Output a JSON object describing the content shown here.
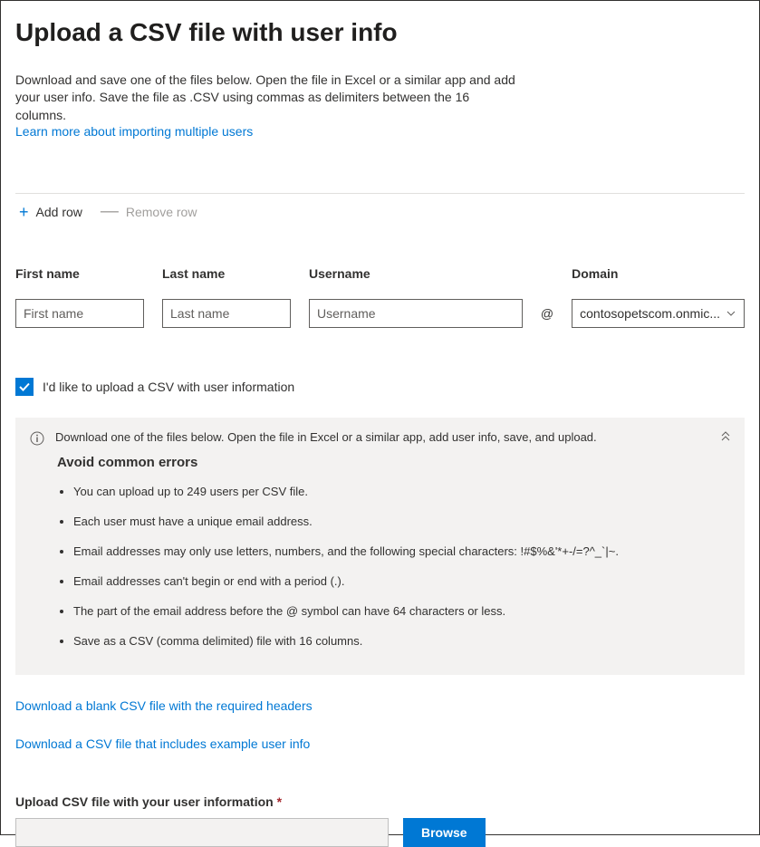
{
  "title": "Upload a CSV file with user info",
  "intro": "Download and save one of the files below. Open the file in Excel or a similar app and add your user info. Save the file as .CSV using commas as delimiters between the 16 columns.",
  "learnMore": "Learn more about importing multiple users",
  "toolbar": {
    "add": "Add row",
    "remove": "Remove row"
  },
  "fields": {
    "first": {
      "label": "First name",
      "placeholder": "First name"
    },
    "last": {
      "label": "Last name",
      "placeholder": "Last name"
    },
    "user": {
      "label": "Username",
      "placeholder": "Username"
    },
    "at": "@",
    "domain": {
      "label": "Domain",
      "value": "contosopetscom.onmic..."
    }
  },
  "checkbox": {
    "label": "I'd like to upload a CSV with user information"
  },
  "info": {
    "header": "Download one of the files below. Open the file in Excel or a similar app, add user info, save, and upload.",
    "subtitle": "Avoid common errors",
    "items": [
      "You can upload up to 249 users per CSV file.",
      "Each user must have a unique email address.",
      "Email addresses may only use letters, numbers, and the following special characters: !#$%&'*+-/=?^_`|~.",
      "Email addresses can't begin or end with a period (.).",
      "The part of the email address before the @ symbol can have 64 characters or less.",
      "Save as a CSV (comma delimited) file with 16 columns."
    ]
  },
  "downloads": {
    "blank": "Download a blank CSV file with the required headers",
    "example": "Download a CSV file that includes example user info"
  },
  "upload": {
    "label": "Upload CSV file with your user information",
    "button": "Browse"
  }
}
